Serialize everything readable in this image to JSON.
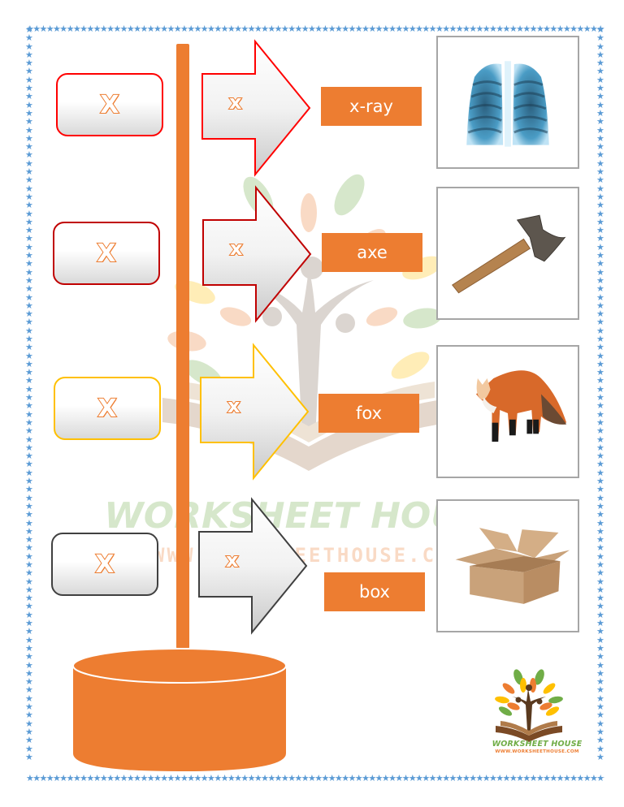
{
  "worksheet": {
    "border_style": "blue-stars",
    "colors": {
      "accent_orange": "#ed7d31",
      "border_blue": "#5b9bd5",
      "row1_outline": "#ff0000",
      "row2_outline": "#c00000",
      "row3_outline": "#ffc000",
      "row4_outline": "#404040"
    },
    "rows": [
      {
        "card_letter": "X",
        "arrow_letter": "x",
        "word": "x-ray",
        "picture": "chest-x-ray"
      },
      {
        "card_letter": "X",
        "arrow_letter": "x",
        "word": "axe",
        "picture": "axe"
      },
      {
        "card_letter": "X",
        "arrow_letter": "x",
        "word": "fox",
        "picture": "fox"
      },
      {
        "card_letter": "X",
        "arrow_letter": "x",
        "word": "box",
        "picture": "cardboard-box"
      }
    ],
    "watermark": {
      "title": "WORKSHEET HOUSE",
      "url": "WWW.WORKSHEETHOUSE.COM"
    },
    "logo": {
      "title": "WORKSHEET HOUSE",
      "url": "WWW.WORKSHEETHOUSE.COM"
    },
    "stars": "★★★★★★★★★★★★★★★★★★★★★★★★★★★★★★★★★★★★★★★★★★★★★★★★★★★★★★★★★★★★★★★★★★★★★★★★★★★★★★★★★★★★★★★★"
  }
}
